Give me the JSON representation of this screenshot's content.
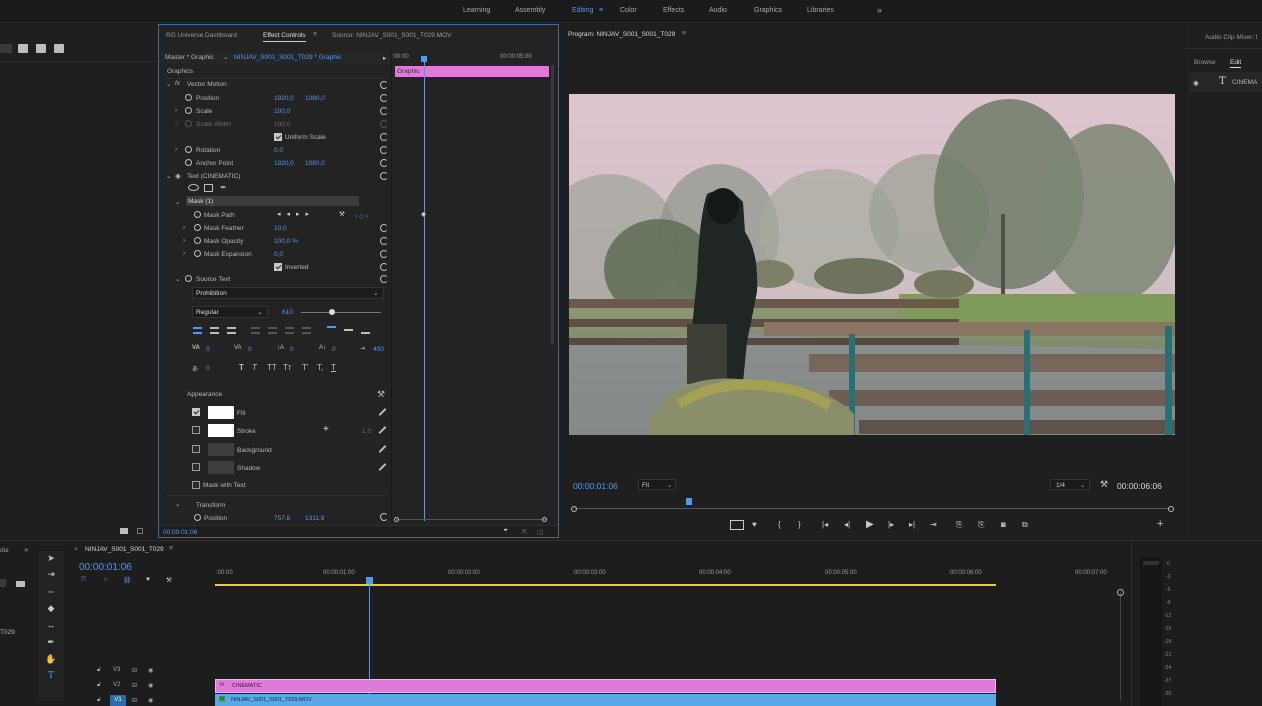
{
  "workspaces": [
    {
      "label": "Learning"
    },
    {
      "label": "Assembly"
    },
    {
      "label": "Editing"
    },
    {
      "label": "Color"
    },
    {
      "label": "Effects"
    },
    {
      "label": "Audio"
    },
    {
      "label": "Graphics"
    },
    {
      "label": "Libraries"
    }
  ],
  "workspaces_more": "»",
  "effect_panel": {
    "tabs": [
      "RG Universe Dashboard",
      "Effect Controls",
      "Source: NINJAV_S001_S001_T029.MOV"
    ],
    "master_label": "Master * Graphic",
    "clip_label": "NINJAV_S001_S001_T029 * Graphic",
    "section_graphics": "Graphics",
    "vector_motion": "Vector Motion",
    "position_label": "Position",
    "position_x": "1920,0",
    "position_y": "1080,0",
    "scale_label": "Scale",
    "scale_value": "100,0",
    "scale_width_label": "Scale Width",
    "scale_width_value": "100,0",
    "uniform_scale": "Uniform Scale",
    "rotation_label": "Rotation",
    "rotation_value": "0,0",
    "anchor_label": "Anchor Point",
    "anchor_x": "1920,0",
    "anchor_y": "1080,0",
    "text_layer": "Text (CINEMATIC)",
    "mask_label": "Mask (1)",
    "mask_path": "Mask Path",
    "mask_feather": "Mask Feather",
    "mask_feather_value": "10,0",
    "mask_opacity": "Mask Opacity",
    "mask_opacity_value": "100,0 %",
    "mask_expansion": "Mask Expansion",
    "mask_expansion_value": "0,0",
    "inverted": "Inverted",
    "source_text": "Source Text",
    "font_family": "Prohibition",
    "font_style": "Regular",
    "font_size": "610",
    "tracking_vals": [
      "0",
      "0",
      "0",
      "0",
      "400"
    ],
    "tsume_val": "0",
    "appearance": "Appearance",
    "fill": "Fill",
    "stroke": "Stroke",
    "stroke_width": "1,0",
    "background": "Background",
    "shadow": "Shadow",
    "mask_with_text": "Mask with Text",
    "transform": "Transform",
    "transform_position": "Position",
    "transform_pos_x": "757,8",
    "transform_pos_y": "1311,9",
    "timecode": "00:00:01:06",
    "mini_tl_start": ":00:00",
    "mini_tl_end": "00:00:05:00",
    "mini_clip_label": "Graphic",
    "text_style_glyphs": [
      "T",
      "T",
      "TT",
      "Tт",
      "T'",
      "T,",
      "T"
    ]
  },
  "program": {
    "title": "Program: NINJAV_S001_S001_T029",
    "timecode": "00:00:01:06",
    "fit": "Fit",
    "resolution": "1/4",
    "duration": "00:00:06:06"
  },
  "audio_mixer": {
    "title": "Audio Clip Mixer: I",
    "tabs": [
      "Browse",
      "Edit"
    ],
    "item": "CINEMA"
  },
  "timeline": {
    "panel_left_label": "dia",
    "panel_left_more": "»",
    "sequence_name": "NINJAV_S001_S001_T029",
    "timecode": "00:00:01:06",
    "ruler": [
      ":00:00",
      "00:00:01:00",
      "00:00:02:00",
      "00:00:03:00",
      "00:00:04:00",
      "00:00:05:00",
      "00:00:06:00",
      "00:00:07:00"
    ],
    "tracks": [
      {
        "name": "V3"
      },
      {
        "name": "V2"
      },
      {
        "name": "V1"
      }
    ],
    "clip_text": "CINEMATIC",
    "clip_video": "NINJAV_S001_S001_T029.MOV",
    "left_code": "T029",
    "meter_ticks": [
      "0",
      "-3",
      "-6",
      "-9",
      "-12",
      "-15",
      "-18",
      "-21",
      "-24",
      "-27",
      "-30"
    ]
  },
  "colors": {
    "accent": "#4b9cf5",
    "graphic_clip": "#e07ad8",
    "video_clip": "#5aa8e8",
    "playhead": "#4b9cf5",
    "work_area": "#e6d13a"
  }
}
